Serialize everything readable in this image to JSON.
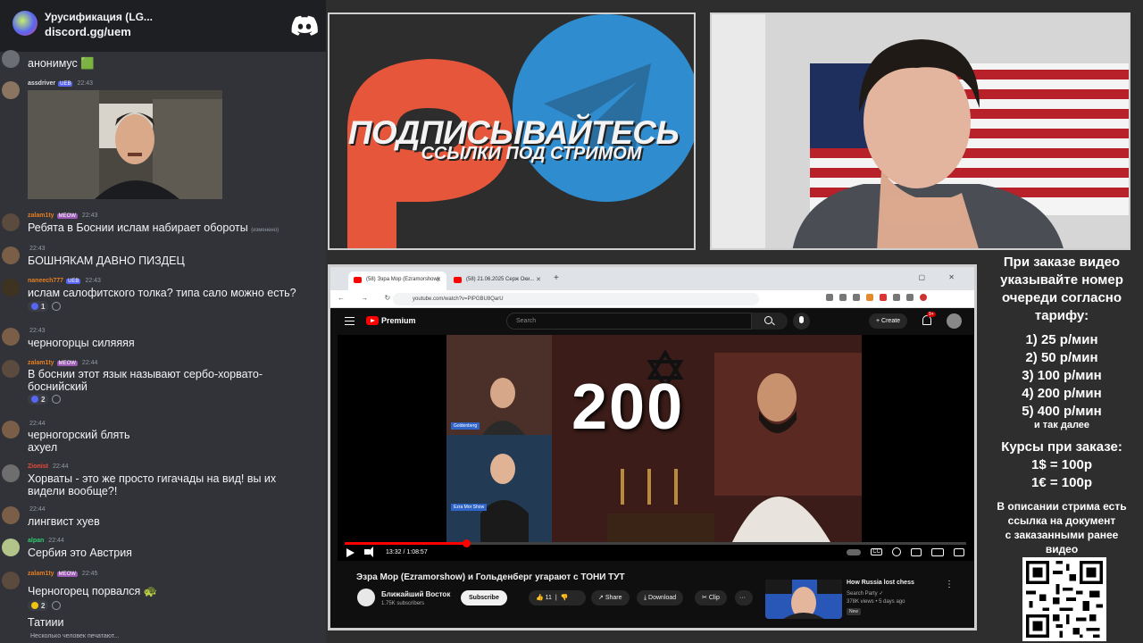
{
  "discord": {
    "server_name": "Урусификация (LG...",
    "server_link": "discord.gg/uem",
    "messages": [
      {
        "nick": "",
        "time": "",
        "text": "анонимус 🟩",
        "nick_color": "#b5bac1"
      },
      {
        "nick": "assdriver",
        "badge": "UEB",
        "time": "22:43",
        "text": "",
        "nick_color": "#dbdee1"
      },
      {
        "nick": "zalam1ty",
        "badge": "MEOW",
        "time": "22:43",
        "text": "Ребята в Боснии ислам набирает обороты",
        "edited": "(изменено)",
        "nick_color": "#e67e22"
      },
      {
        "nick": "",
        "time": "22:43",
        "text": "БОШНЯКАМ ДАВНО ПИЗДЕЦ",
        "nick_color": "#b5bac1"
      },
      {
        "nick": "naneech777",
        "badge": "UEB",
        "time": "22:43",
        "text": "ислам салофитского толка? типа сало можно есть?",
        "nick_color": "#e67e22",
        "reactions": [
          "1"
        ]
      },
      {
        "nick": "",
        "time": "22:43",
        "text": "черногорцы силяяяя",
        "nick_color": "#b5bac1"
      },
      {
        "nick": "zalam1ty",
        "badge": "MEOW",
        "time": "22:44",
        "text": "В боснии этот язык называют сербо-хорвато-боснийский",
        "nick_color": "#e67e22",
        "reactions": [
          "2"
        ]
      },
      {
        "nick": "",
        "time": "22:44",
        "text": "черногорский блять ахуел",
        "nick_color": "#b5bac1"
      },
      {
        "nick": "Zionist",
        "time": "22:44",
        "text": "Хорваты - это же просто гигачады на вид! вы их видели вообще?!",
        "nick_color": "#e74c3c"
      },
      {
        "nick": "",
        "time": "22:44",
        "text": "лингвист хуев",
        "nick_color": "#b5bac1"
      },
      {
        "nick": "alpan",
        "time": "22:44",
        "text": "Сербия это Австрия",
        "nick_color": "#2ecc71"
      },
      {
        "nick": "zalam1ty",
        "badge": "MEOW",
        "time": "22:45",
        "text": "Черногорец порвался 🐢",
        "nick_color": "#e67e22",
        "reactions": [
          "2"
        ]
      },
      {
        "nick": "",
        "time": "",
        "text": "Татиии",
        "nick_color": "#b5bac1"
      }
    ],
    "typing": "Несколько человек печатают..."
  },
  "promo": {
    "title": "ПОДПИСЫВАЙТЕСЬ",
    "subtitle": "ССЫЛКИ ПОД СТРИМОМ"
  },
  "browser": {
    "tabs": [
      "(58) Эзра Мор (Ezramorshow)",
      "(58) 21.06.2025 Серж Оки..."
    ],
    "url": "youtube.com/watch?v=PlPGBU8QarU",
    "yt_brand": "Premium",
    "search_placeholder": "Search",
    "create_label": "Create",
    "notif_count": "9+",
    "player": {
      "overlay_number": "200",
      "tag_left_top": "Goldenberg",
      "tag_left_bottom": "Ezra Mor Show",
      "timecode": "13:32 / 1:08:57",
      "progress_fraction": 0.196
    },
    "video_title": "Эзра Мор (Ezramorshow) и Гольденберг угарают с ТОНИ ТУТ",
    "channel_name": "Ближайший Восток",
    "channel_subs": "1.75K subscribers",
    "subscribe_label": "Subscribe",
    "likes": "11",
    "share_label": "Share",
    "download_label": "Download",
    "clip_label": "Clip",
    "more_label": "···",
    "recommended": {
      "title": "How Russia lost chess",
      "channel": "Search Party ✓",
      "stats": "378K views • 5 days ago",
      "badge": "New"
    }
  },
  "order": {
    "heading": [
      "При заказе видео",
      "указывайте номер",
      "очереди согласно",
      "тарифу:"
    ],
    "tariffs": [
      "1) 25 р/мин",
      "2) 50 р/мин",
      "3) 100 р/мин",
      "4) 200 р/мин",
      "5) 400 р/мин"
    ],
    "etc": "и так далее",
    "rates_heading": "Курсы при заказе:",
    "rates": [
      "1$ = 100р",
      "1€ = 100р"
    ],
    "footer": [
      "В описании стрима есть",
      "ссылка на документ",
      "с заказанными ранее",
      "видео"
    ]
  },
  "colors": {
    "discord_bg": "#313338",
    "discord_header": "#1e1f22",
    "yt_red": "#ff0000",
    "telegram_blue": "#2e8ccf",
    "patreon_orange": "#e5563a"
  }
}
